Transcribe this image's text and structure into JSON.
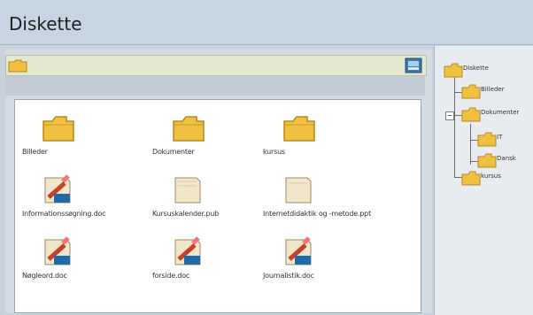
{
  "window": {
    "title": "Diskette"
  },
  "toolbar": {
    "folder_icon": "folder-icon",
    "view_icon": "view-toggle-icon"
  },
  "files": [
    {
      "label": "Billeder",
      "icon": "folder-icon"
    },
    {
      "label": "Dokumenter",
      "icon": "folder-icon"
    },
    {
      "label": "kursus",
      "icon": "folder-icon"
    },
    {
      "label": "Informationssøgning.doc",
      "icon": "word-document-icon"
    },
    {
      "label": "Kursuskalender.pub",
      "icon": "publisher-document-icon"
    },
    {
      "label": "Internetdidaktik og -metode.ppt",
      "icon": "presentation-document-icon"
    },
    {
      "label": "Nøgleord.doc",
      "icon": "word-document-icon"
    },
    {
      "label": "forside.doc",
      "icon": "word-document-icon"
    },
    {
      "label": "Journalistik.doc",
      "icon": "word-document-icon"
    }
  ],
  "tree": [
    {
      "label": "Diskette",
      "level": 0
    },
    {
      "label": "Billeder",
      "level": 1
    },
    {
      "label": "Dokumenter",
      "level": 1,
      "expander": "−"
    },
    {
      "label": "IT",
      "level": 2
    },
    {
      "label": "Dansk",
      "level": 2
    },
    {
      "label": "kursus",
      "level": 1
    }
  ],
  "colors": {
    "titlebar": "#c6d4e3",
    "toolbar": "#e3e9d1",
    "folder": "#f0c040"
  }
}
